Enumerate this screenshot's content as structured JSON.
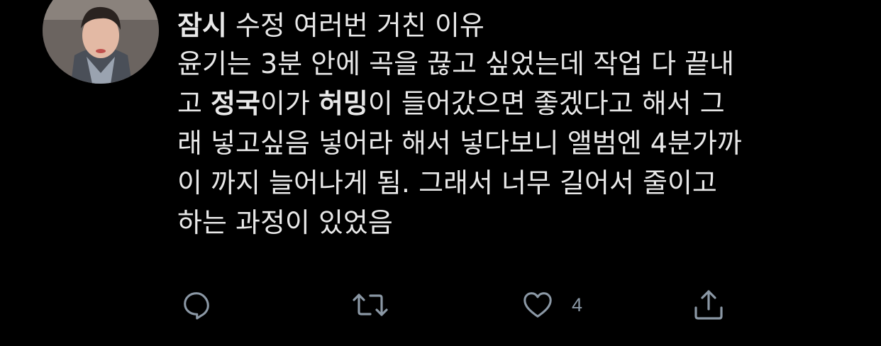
{
  "tweet": {
    "title_bold": "잠시",
    "title_rest": "수정 여러번 거친 이유",
    "lines": {
      "l1": "윤기는 3분 안에 곡을 끊고 싶었는데 작업 다 끝내",
      "l2_a": "고 ",
      "l2_b": "정국",
      "l2_c": "이가 ",
      "l2_d": "허밍",
      "l2_e": "이 들어갔으면 좋겠다고 해서 그",
      "l3": "래 넣고싶음 넣어라 해서 넣다보니 앨범엔 4분가까",
      "l4": "이 까지 늘어나게 됨. 그래서 너무 길어서 줄이고",
      "l5": "하는 과정이 있었음"
    }
  },
  "actions": {
    "reply_icon": "reply-icon",
    "retweet_icon": "retweet-icon",
    "like_icon": "heart-icon",
    "like_count": "4",
    "share_icon": "share-icon"
  },
  "colors": {
    "background": "#000000",
    "text": "#e8e8e8",
    "icon": "#8b98a5"
  }
}
